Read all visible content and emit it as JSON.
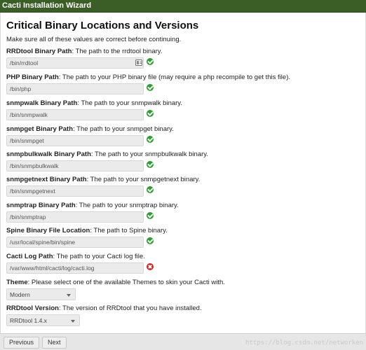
{
  "window": {
    "title": "Cacti Installation Wizard"
  },
  "page": {
    "heading": "Critical Binary Locations and Versions",
    "intro": "Make sure all of these values are correct before continuing."
  },
  "fields": [
    {
      "label": "RRDtool Binary Path",
      "desc": ": The path to the rrdtool binary.",
      "value": "/bin/rrdtool",
      "status": "ok",
      "browse_icon": "file-browse-icon"
    },
    {
      "label": "PHP Binary Path",
      "desc": ": The path to your PHP binary file (may require a php recompile to get this file).",
      "value": "/bin/php",
      "status": "ok"
    },
    {
      "label": "snmpwalk Binary Path",
      "desc": ": The path to your snmpwalk binary.",
      "value": "/bin/snmpwalk",
      "status": "ok"
    },
    {
      "label": "snmpget Binary Path",
      "desc": ": The path to your snmpget binary.",
      "value": "/bin/snmpget",
      "status": "ok"
    },
    {
      "label": "snmpbulkwalk Binary Path",
      "desc": ": The path to your snmpbulkwalk binary.",
      "value": "/bin/snmpbulkwalk",
      "status": "ok"
    },
    {
      "label": "snmpgetnext Binary Path",
      "desc": ": The path to your snmpgetnext binary.",
      "value": "/bin/snmpgetnext",
      "status": "ok"
    },
    {
      "label": "snmptrap Binary Path",
      "desc": ": The path to your snmptrap binary.",
      "value": "/bin/snmptrap",
      "status": "ok"
    },
    {
      "label": "Spine Binary File Location",
      "desc": ": The path to Spine binary.",
      "value": "/usr/local/spine/bin/spine",
      "status": "ok"
    },
    {
      "label": "Cacti Log Path",
      "desc": ": The path to your Cacti log file.",
      "value": "/var/www/html/cacti/log/cacti.log",
      "status": "error"
    }
  ],
  "theme": {
    "label": "Theme",
    "desc": ": Please select one of the available Themes to skin your Cacti with.",
    "selected": "Modern"
  },
  "rrdtool_version": {
    "label": "RRDtool Version",
    "desc": ": The version of RRDtool that you have installed.",
    "selected": "RRDtool 1.4.x"
  },
  "footer": {
    "previous_label": "Previous",
    "next_label": "Next",
    "watermark": "https://blog.csdn.net/networken"
  },
  "colors": {
    "titlebar": "#3a5e26",
    "ok": "#2e9d33",
    "error": "#d32626"
  }
}
